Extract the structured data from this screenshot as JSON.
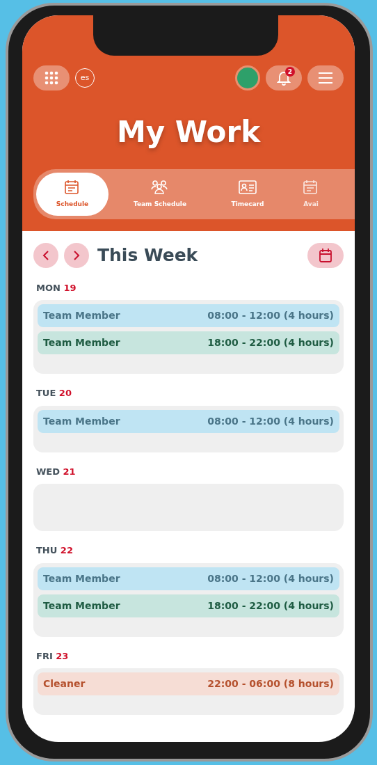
{
  "header": {
    "title": "My Work",
    "notification_count": "2",
    "logo": "es"
  },
  "tabs": [
    {
      "label": "Schedule",
      "selected": true,
      "kind": "calendar"
    },
    {
      "label": "Team Schedule",
      "selected": false,
      "kind": "people"
    },
    {
      "label": "Timecard",
      "selected": false,
      "kind": "card"
    },
    {
      "label": "Avai",
      "selected": false,
      "kind": "calendar"
    }
  ],
  "week": {
    "title": "This Week"
  },
  "days": [
    {
      "weekday": "MON",
      "date": "19",
      "shifts": [
        {
          "role": "Team Member",
          "time": "08:00 - 12:00 (4 hours)",
          "color": "#bfe4f3"
        },
        {
          "role": "Team Member",
          "time": "18:00 - 22:00 (4 hours)",
          "color": "#c7e5de"
        }
      ]
    },
    {
      "weekday": "TUE",
      "date": "20",
      "shifts": [
        {
          "role": "Team Member",
          "time": "08:00 - 12:00 (4 hours)",
          "color": "#bfe4f3"
        }
      ]
    },
    {
      "weekday": "WED",
      "date": "21"
    },
    {
      "weekday": "THU",
      "date": "22",
      "shifts": [
        {
          "role": "Team Member",
          "time": "08:00 - 12:00 (4 hours)",
          "color": "#bfe4f3"
        },
        {
          "role": "Team Member",
          "time": "18:00 - 22:00 (4 hours)",
          "color": "#c7e5de"
        }
      ]
    },
    {
      "weekday": "FRI",
      "date": "23",
      "shifts": [
        {
          "role": "Cleaner",
          "time": "22:00 - 06:00 (8 hours)",
          "color": "#f6ddd5"
        }
      ]
    }
  ]
}
